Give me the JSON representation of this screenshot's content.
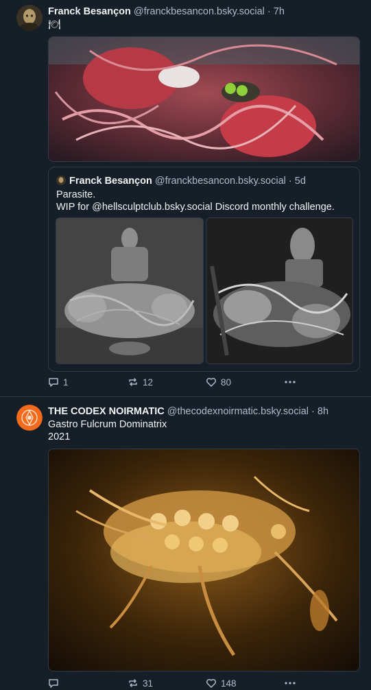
{
  "post1": {
    "author_name": "Franck Besançon",
    "handle": "@franckbesancon.bsky.social",
    "time": "· 7h",
    "text": "🍽",
    "quote": {
      "author_name": "Franck Besançon",
      "handle": "@franckbesancon.bsky.social",
      "time": "· 5d",
      "line1": "Parasite.",
      "line2": "WIP for @hellsculptclub.bsky.social Discord monthly challenge."
    },
    "actions": {
      "replies": "1",
      "reposts": "12",
      "likes": "80"
    }
  },
  "post2": {
    "author_name": "THE CODEX NOIRMATIC",
    "handle": "@thecodexnoirmatic.bsky.social",
    "time": "· 8h",
    "line1": "Gastro Fulcrum Dominatrix",
    "line2": "2021",
    "actions": {
      "replies": "",
      "reposts": "31",
      "likes": "148"
    }
  },
  "colors": {
    "background": "#161e27",
    "border": "#2e3b4a",
    "muted": "#aebbc9",
    "avatar2": "#f26a1b"
  },
  "icons": [
    "reply-icon",
    "repost-icon",
    "like-icon",
    "more-icon"
  ]
}
